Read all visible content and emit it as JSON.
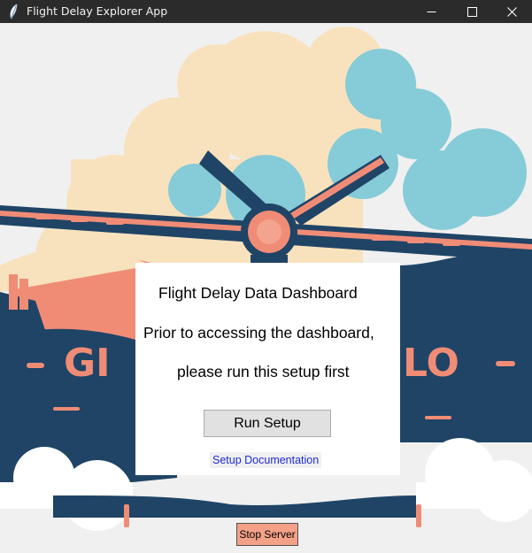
{
  "window": {
    "title": "Flight Delay Explorer App",
    "icon": "feather-icon"
  },
  "background": {
    "logo_text_left": "GI",
    "logo_text_right": "LO",
    "colors": {
      "navy": "#1f4466",
      "salmon": "#f08c76",
      "cream": "#f8e2bd",
      "sky": "#86cbd8",
      "backdrop": "#f0f0f0"
    }
  },
  "dialog": {
    "heading": "Flight Delay Data Dashboard",
    "line1": "Prior to accessing the dashboard,",
    "line2": "please run this setup first",
    "run_button": "Run Setup",
    "doc_link": "Setup Documentation"
  },
  "footer": {
    "stop_button": "Stop Server"
  }
}
